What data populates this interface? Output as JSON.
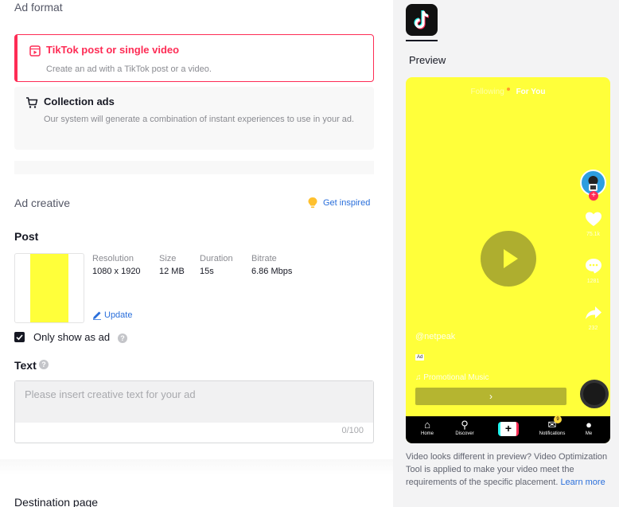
{
  "ad_format": {
    "heading": "Ad format",
    "options": [
      {
        "title": "TikTok post or single video",
        "description": "Create an ad with a TikTok post or a video.",
        "selected": true,
        "icon": "video-post-icon"
      },
      {
        "title": "Collection ads",
        "description": "Our system will generate a combination of instant experiences to use in your ad.",
        "selected": false,
        "icon": "cart-icon"
      }
    ]
  },
  "ad_creative": {
    "heading": "Ad creative",
    "get_inspired": "Get inspired",
    "post_heading": "Post",
    "video": {
      "resolution_label": "Resolution",
      "resolution": "1080 x 1920",
      "size_label": "Size",
      "size": "12 MB",
      "duration_label": "Duration",
      "duration": "15s",
      "bitrate_label": "Bitrate",
      "bitrate": "6.86 Mbps",
      "update": "Update"
    },
    "only_show_as_ad": {
      "label": "Only show as ad",
      "checked": true
    },
    "text": {
      "heading": "Text",
      "placeholder": "Please insert creative text for your ad",
      "counter": "0/100"
    }
  },
  "destination": {
    "heading": "Destination page"
  },
  "preview": {
    "label": "Preview",
    "tabs": {
      "following": "Following",
      "for_you": "For You"
    },
    "likes": "75.1k",
    "comments": "1281",
    "shares": "232",
    "username": "@netpeak",
    "ad_tag": "Ad",
    "music": "♫ Promotional Music",
    "cta_arrow": "›",
    "nav": {
      "home": "Home",
      "discover": "Discover",
      "notifications": "Notifications",
      "notifications_badge": "9",
      "me": "Me"
    },
    "note": "Video looks different in preview? Video Optimization Tool is applied to make your video meet the requirements of the specific placement.",
    "learn_more": "Learn more"
  },
  "colors": {
    "accent": "#fe2c55",
    "link": "#2a6fdb",
    "video_bg": "#ffff3a"
  }
}
